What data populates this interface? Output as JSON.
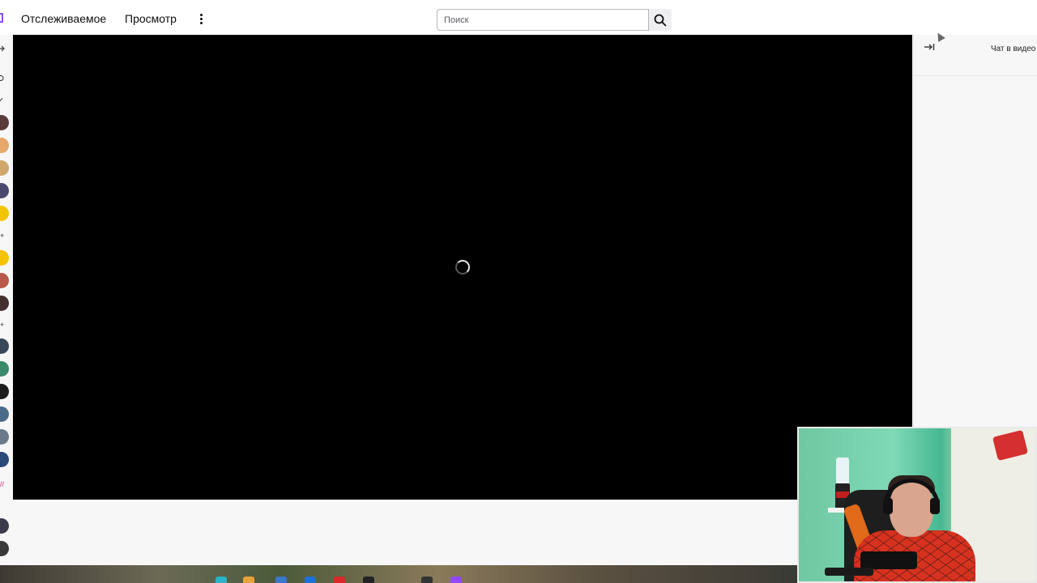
{
  "topbar": {
    "nav": {
      "following_label": "Отслеживаемое",
      "browse_label": "Просмотр"
    },
    "search": {
      "placeholder": "Поиск"
    }
  },
  "chat": {
    "title": "Чат в видео"
  },
  "colors": {
    "accent": "#9147ff",
    "player_bg": "#000000",
    "page_bg": "#f7f7f8"
  },
  "icons": {
    "more": "more-vertical-icon",
    "search": "search-icon",
    "collapse": "collapse-right-icon",
    "loading": "loading-spinner-icon"
  }
}
